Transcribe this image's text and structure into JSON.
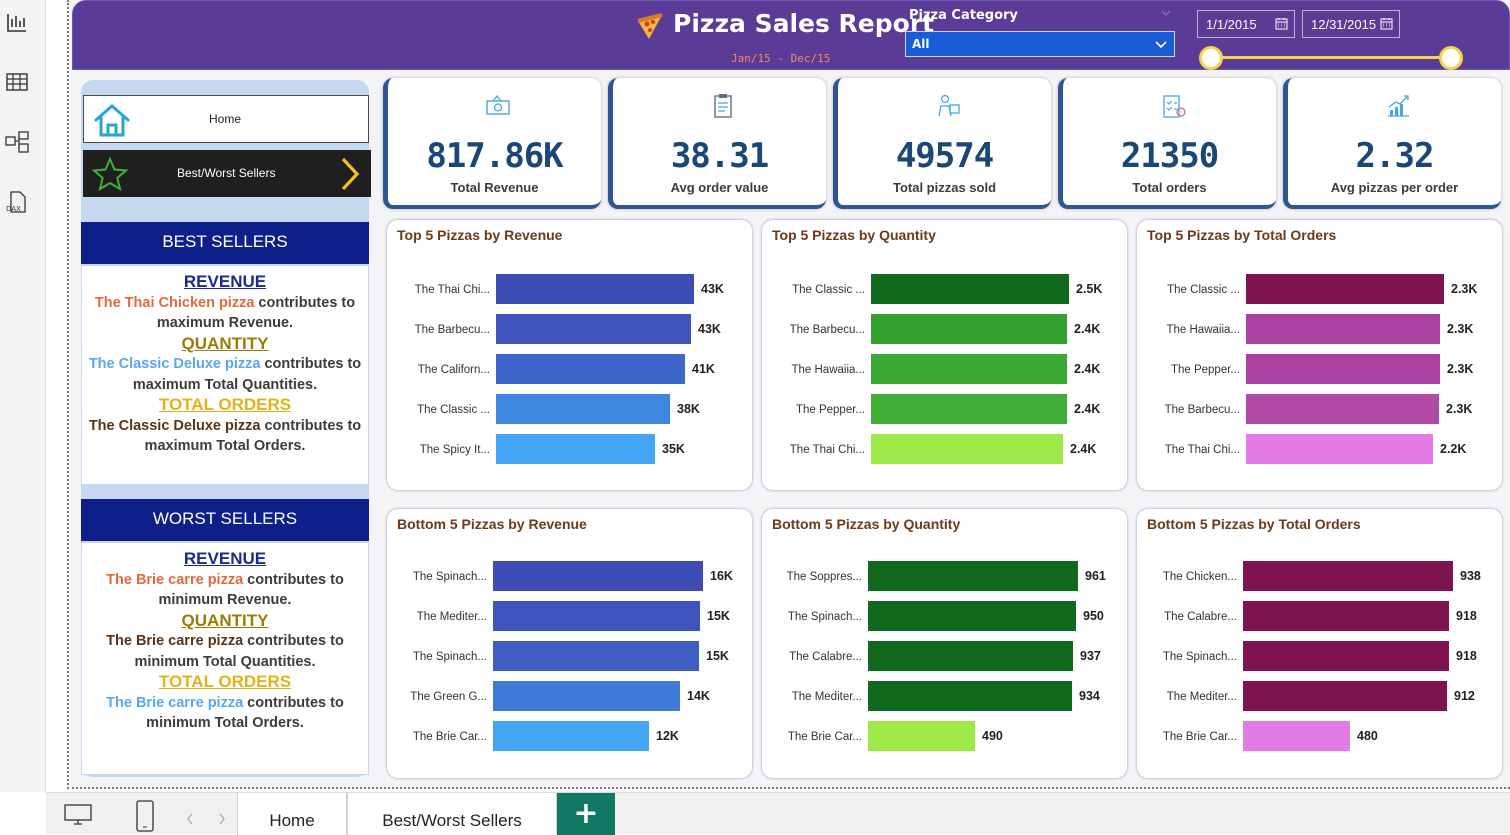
{
  "header": {
    "title": "Pizza Sales Report",
    "subtitle": "Jan/15  -  Dec/15",
    "category_label": "Pizza Category",
    "category_value": "All",
    "start_date": "1/1/2015",
    "end_date": "12/31/2015",
    "accent": "#5a3b96"
  },
  "nav": {
    "home_label": "Home",
    "bw_label": "Best/Worst Sellers"
  },
  "best": {
    "heading": "BEST SELLERS",
    "rev_head": "REVENUE",
    "rev_pizza": "The Thai Chicken pizza",
    "rev_text": " contributes to maximum Revenue.",
    "qty_head": "QUANTITY",
    "qty_pizza": "The Classic Deluxe pizza",
    "qty_text": " contributes to maximum Total Quantities.",
    "ord_head": "TOTAL ORDERS",
    "ord_pizza": "The Classic Deluxe pizza",
    "ord_text": " contributes to maximum Total Orders."
  },
  "worst": {
    "heading": "WORST SELLERS",
    "rev_head": "REVENUE",
    "rev_pizza": "The Brie carre pizza",
    "rev_text": " contributes to minimum Revenue.",
    "qty_head": "QUANTITY",
    "qty_pizza": "The Brie carre pizza",
    "qty_text": " contributes to minimum Total Quantities.",
    "ord_head": "TOTAL ORDERS",
    "ord_pizza": "The Brie carre pizza",
    "ord_text": " contributes to minimum Total Orders."
  },
  "kpis": [
    {
      "value": "817.86K",
      "label": "Total Revenue",
      "icon": "money-icon"
    },
    {
      "value": "38.31",
      "label": "Avg order value",
      "icon": "clipboard-icon"
    },
    {
      "value": "49574",
      "label": "Total pizzas sold",
      "icon": "delivery-icon"
    },
    {
      "value": "21350",
      "label": "Total orders",
      "icon": "checklist-icon"
    },
    {
      "value": "2.32",
      "label": "Avg pizzas per order",
      "icon": "growth-chart-icon"
    }
  ],
  "tabs": {
    "home": "Home",
    "bw": "Best/Worst Sellers",
    "add": "+"
  },
  "chart_data": [
    {
      "type": "bar",
      "title": "Top 5 Pizzas by Revenue",
      "categories": [
        "The Thai Chi...",
        "The Barbecu...",
        "The Californ...",
        "The Classic ...",
        "The Spicy It..."
      ],
      "values": [
        43.4,
        42.8,
        41.4,
        38.2,
        34.8
      ],
      "labels": [
        "43K",
        "43K",
        "41K",
        "38K",
        "35K"
      ],
      "colors": [
        "#3d4db5",
        "#3f55bd",
        "#3f66c9",
        "#3f86e0",
        "#44a5f5"
      ]
    },
    {
      "type": "bar",
      "title": "Top 5 Pizzas by Quantity",
      "categories": [
        "The Classic ...",
        "The Barbecu...",
        "The Hawaiia...",
        "The Pepper...",
        "The Thai Chi..."
      ],
      "values": [
        2.45,
        2.43,
        2.42,
        2.42,
        2.37
      ],
      "labels": [
        "2.5K",
        "2.4K",
        "2.4K",
        "2.4K",
        "2.4K"
      ],
      "colors": [
        "#10691c",
        "#34a02e",
        "#3aa833",
        "#3fae37",
        "#9ee84a"
      ]
    },
    {
      "type": "bar",
      "title": "Top 5 Pizzas by Total Orders",
      "categories": [
        "The Classic ...",
        "The Hawaiia...",
        "The Pepper...",
        "The Barbecu...",
        "The Thai Chi..."
      ],
      "values": [
        2.33,
        2.28,
        2.28,
        2.27,
        2.2
      ],
      "labels": [
        "2.3K",
        "2.3K",
        "2.3K",
        "2.3K",
        "2.2K"
      ],
      "colors": [
        "#7d1450",
        "#ab41a0",
        "#ab41a0",
        "#b04aa6",
        "#e27be6"
      ]
    },
    {
      "type": "bar",
      "title": "Bottom 5 Pizzas by Revenue",
      "categories": [
        "The Spinach...",
        "The Mediter...",
        "The Spinach...",
        "The Green G...",
        "The Brie Car..."
      ],
      "values": [
        15.6,
        15.4,
        15.3,
        13.9,
        11.6
      ],
      "labels": [
        "16K",
        "15K",
        "15K",
        "14K",
        "12K"
      ],
      "colors": [
        "#3d4db5",
        "#3f55bd",
        "#3f5ec3",
        "#3f7ad6",
        "#44a5f5"
      ]
    },
    {
      "type": "bar",
      "title": "Bottom 5 Pizzas by Quantity",
      "categories": [
        "The Soppres...",
        "The Spinach...",
        "The Calabre...",
        "The Mediter...",
        "The Brie Car..."
      ],
      "values": [
        961,
        950,
        937,
        934,
        490
      ],
      "labels": [
        "961",
        "950",
        "937",
        "934",
        "490"
      ],
      "colors": [
        "#10691c",
        "#10691c",
        "#10691c",
        "#10691c",
        "#9ee84a"
      ]
    },
    {
      "type": "bar",
      "title": "Bottom 5 Pizzas by Total Orders",
      "categories": [
        "The Chicken...",
        "The Calabre...",
        "The Spinach...",
        "The Mediter...",
        "The Brie Car..."
      ],
      "values": [
        938,
        918,
        918,
        912,
        480
      ],
      "labels": [
        "938",
        "918",
        "918",
        "912",
        "480"
      ],
      "colors": [
        "#7d1450",
        "#7d1450",
        "#7d1450",
        "#7d1450",
        "#e27be6"
      ]
    }
  ]
}
